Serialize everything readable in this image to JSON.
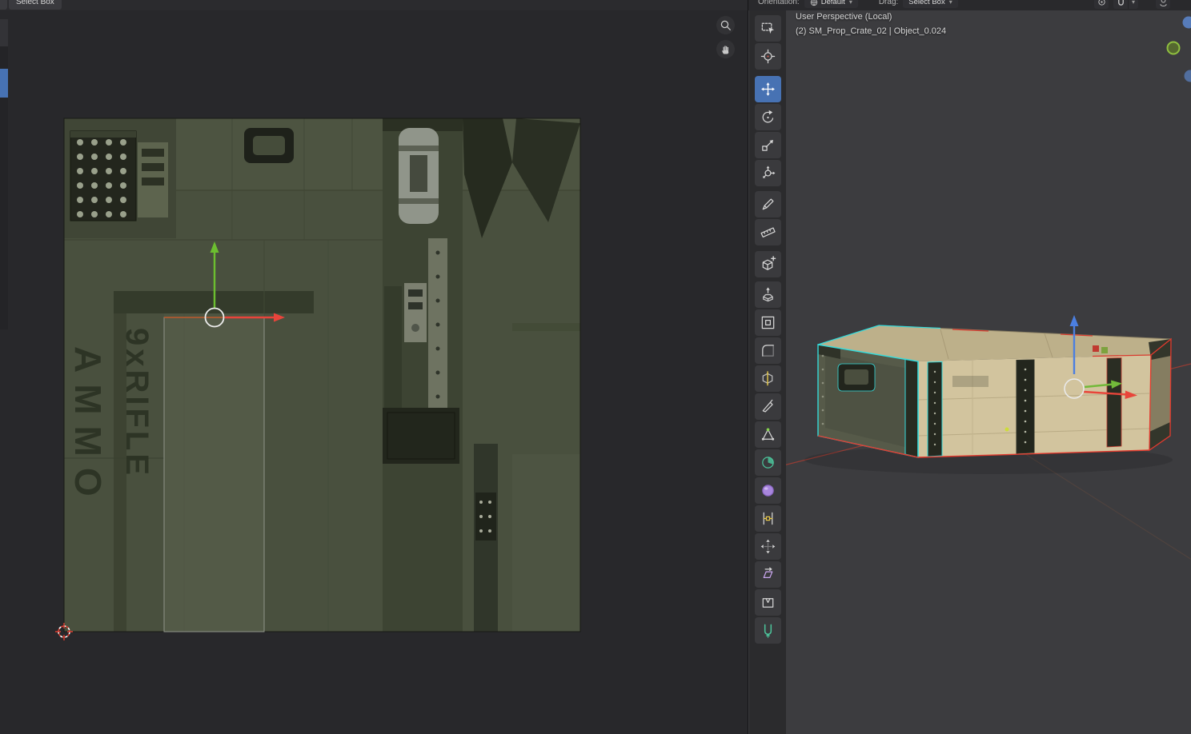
{
  "colors": {
    "accent_blue": "#4772b3",
    "selected_edge_cyan": "#35dbdb",
    "seam_red": "#e8382e",
    "axis_x_red": "#e8453a",
    "axis_y_green": "#72b93a",
    "axis_z_blue": "#4b7fe0"
  },
  "uv_editor": {
    "header": {
      "drag_tool": "Select Box"
    },
    "texture": {
      "stencil_rifle": "9xRIFLE",
      "stencil_ammo": "AMMO"
    }
  },
  "toolbar": {
    "tools": [
      {
        "name": "select-box"
      },
      {
        "name": "cursor",
        "gap": 6
      },
      {
        "name": "move",
        "active": true
      },
      {
        "name": "rotate"
      },
      {
        "name": "scale"
      },
      {
        "name": "transform",
        "gap": 4
      },
      {
        "name": "annotate"
      },
      {
        "name": "measure",
        "gap": 5
      },
      {
        "name": "add-cube",
        "gap": 3
      },
      {
        "name": "extrude-region"
      },
      {
        "name": "inset-faces"
      },
      {
        "name": "bevel"
      },
      {
        "name": "loop-cut"
      },
      {
        "name": "knife"
      },
      {
        "name": "poly-build"
      },
      {
        "name": "spin"
      },
      {
        "name": "smooth"
      },
      {
        "name": "edge-slide"
      },
      {
        "name": "shrink-fatten"
      },
      {
        "name": "shear"
      },
      {
        "name": "rip-region"
      },
      {
        "name": "rip-edge"
      }
    ]
  },
  "viewport": {
    "header": {
      "orientation_label": "Orientation:",
      "orientation_value": "Default",
      "drag_label": "Drag:",
      "drag_value": "Select Box"
    },
    "info_line1": "User Perspective (Local)",
    "info_line2": "(2) SM_Prop_Crate_02 | Object_0.024"
  }
}
